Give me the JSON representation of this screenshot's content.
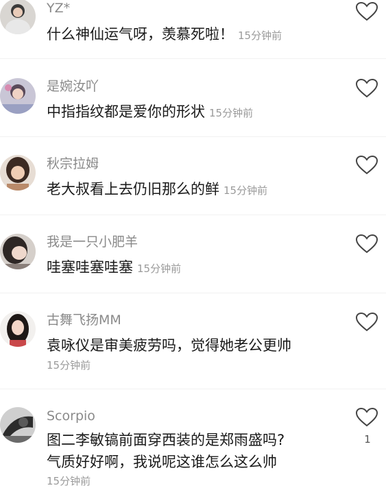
{
  "comments": [
    {
      "username": "YZ*",
      "text": "什么神仙运气呀，羡慕死啦！",
      "time": "15分钟前",
      "avatar_color": "#4a4a4a"
    },
    {
      "username": "是婉汝吖",
      "text": "中指指纹都是爱你的形状",
      "time": "15分钟前",
      "avatar_color": "#7a7fa8"
    },
    {
      "username": "秋宗拉姆",
      "text": "老大叔看上去仍旧那么的鲜",
      "time": "15分钟前",
      "avatar_color": "#6b4a3a"
    },
    {
      "username": "我是一只小肥羊",
      "text": "哇塞哇塞哇塞",
      "time": "15分钟前",
      "avatar_color": "#3f3a38"
    },
    {
      "username": "古舞飞扬MM",
      "text": "袁咏仪是审美疲劳吗，觉得她老公更帅",
      "time": "15分钟前",
      "avatar_color": "#2b2220"
    },
    {
      "username": "Scorpio",
      "text_line1": "图二李敏镐前面穿西装的是郑雨盛吗?",
      "text_line2": "气质好好啊，我说呢这谁怎么这么帅",
      "time": "15分钟前",
      "like_count": "1",
      "avatar_color": "#3a3a3a"
    }
  ],
  "icons": {
    "like": "heart-outline-icon"
  }
}
